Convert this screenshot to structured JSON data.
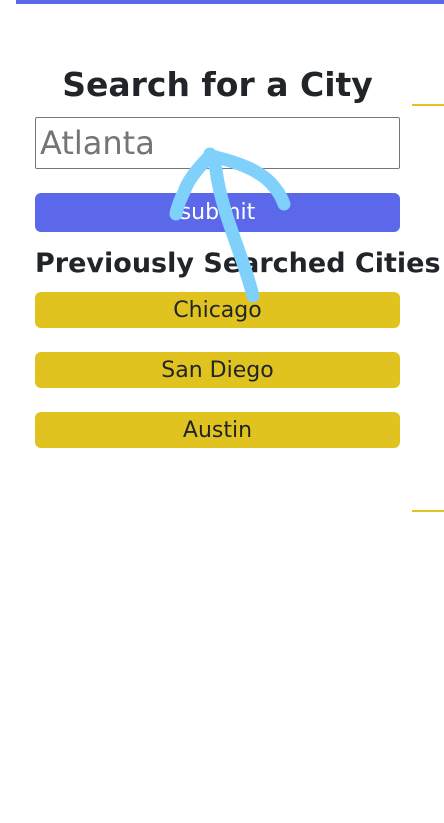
{
  "search": {
    "title": "Search for a City",
    "placeholder": "Atlanta",
    "submit_label": "submit"
  },
  "history": {
    "title": "Previously Searched Cities",
    "cities": [
      "Chicago",
      "San Diego",
      "Austin"
    ]
  },
  "colors": {
    "accent": "#5c68ea",
    "city_button": "#e0c31f",
    "annotation_stroke": "#7fd1fb"
  },
  "annotation": {
    "icon": "hand-drawn-arrow-icon"
  }
}
